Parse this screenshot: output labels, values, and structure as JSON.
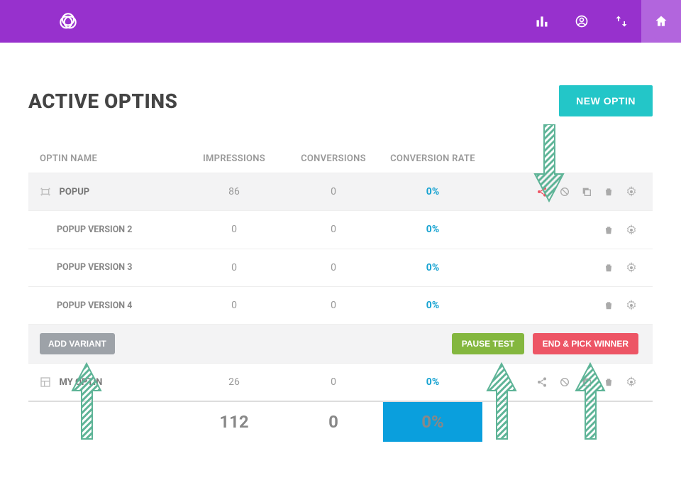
{
  "page": {
    "title": "ACTIVE OPTINS",
    "new_button": "NEW OPTIN"
  },
  "columns": {
    "name": "OPTIN NAME",
    "impressions": "IMPRESSIONS",
    "conversions": "CONVERSIONS",
    "rate": "CONVERSION RATE"
  },
  "rows": {
    "popup": {
      "name": "POPUP",
      "impressions": "86",
      "conversions": "0",
      "rate": "0%"
    },
    "popup_v2": {
      "name": "POPUP VERSION 2",
      "impressions": "0",
      "conversions": "0",
      "rate": "0%"
    },
    "popup_v3": {
      "name": "POPUP VERSION 3",
      "impressions": "0",
      "conversions": "0",
      "rate": "0%"
    },
    "popup_v4": {
      "name": "POPUP VERSION 4",
      "impressions": "0",
      "conversions": "0",
      "rate": "0%"
    },
    "myoptin": {
      "name": "MY OPTIN",
      "impressions": "26",
      "conversions": "0",
      "rate": "0%"
    }
  },
  "buttons": {
    "add_variant": "ADD VARIANT",
    "pause_test": "PAUSE TEST",
    "end_pick": "END & PICK WINNER"
  },
  "totals": {
    "impressions": "112",
    "conversions": "0",
    "rate": "0%"
  }
}
